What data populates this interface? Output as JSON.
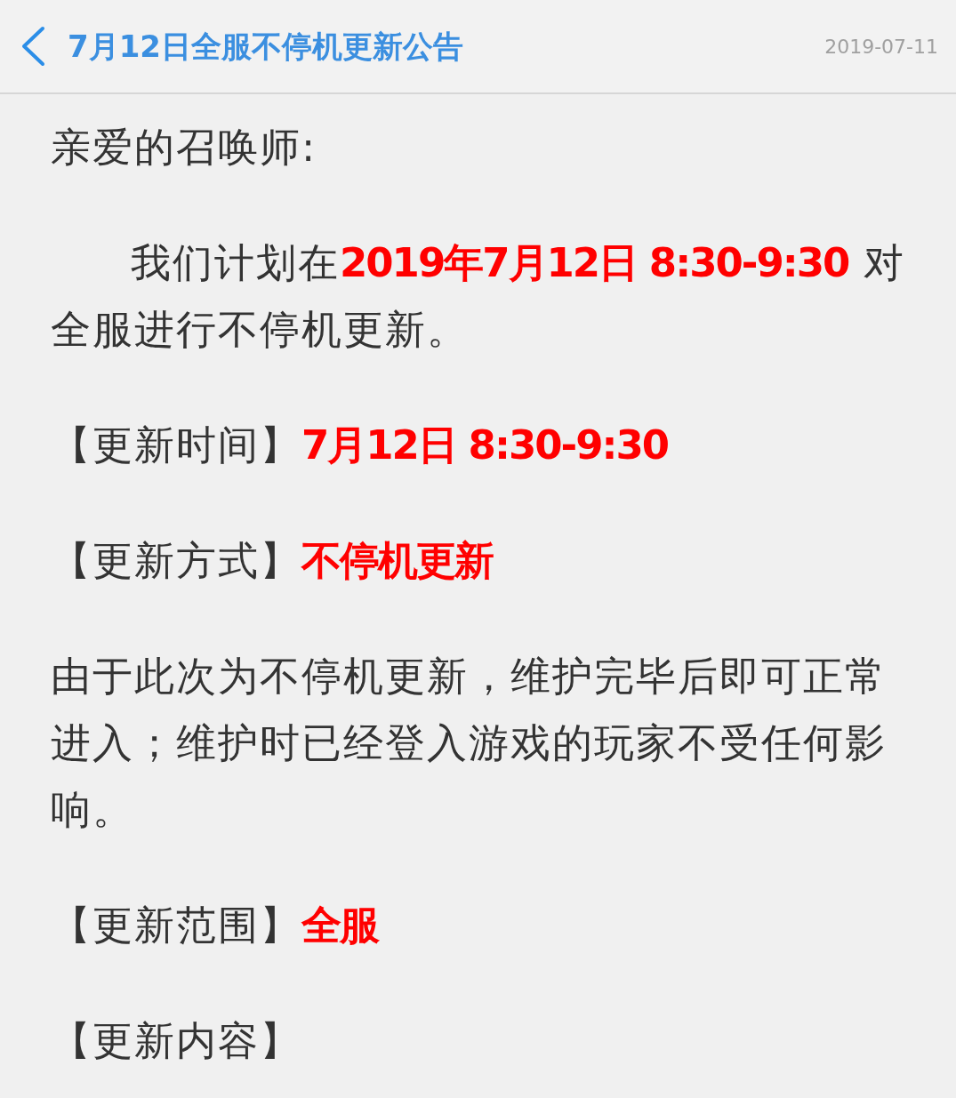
{
  "header": {
    "title": "7月12日全服不停机更新公告",
    "date": "2019-07-11"
  },
  "paragraphs": [
    {
      "indented": false,
      "segments": [
        {
          "text": "亲爱的召唤师:",
          "emphasis": false
        }
      ]
    },
    {
      "indented": true,
      "segments": [
        {
          "text": "我们计划在",
          "emphasis": false
        },
        {
          "text": "2019年7月12日 8:30-9:30",
          "emphasis": true
        },
        {
          "text": " 对全服进行不停机更新。",
          "emphasis": false
        }
      ]
    },
    {
      "indented": false,
      "segments": [
        {
          "text": "【更新时间】",
          "emphasis": false
        },
        {
          "text": "7月12日 8:30-9:30",
          "emphasis": true
        }
      ]
    },
    {
      "indented": false,
      "segments": [
        {
          "text": "【更新方式】",
          "emphasis": false
        },
        {
          "text": "不停机更新",
          "emphasis": true
        }
      ]
    },
    {
      "indented": false,
      "segments": [
        {
          "text": "由于此次为不停机更新，维护完毕后即可正常进入；维护时已经登入游戏的玩家不受任何影响。",
          "emphasis": false
        }
      ]
    },
    {
      "indented": false,
      "segments": [
        {
          "text": "【更新范围】",
          "emphasis": false
        },
        {
          "text": "全服",
          "emphasis": true
        }
      ]
    },
    {
      "indented": false,
      "segments": [
        {
          "text": "【更新内容】",
          "emphasis": false
        }
      ]
    }
  ]
}
